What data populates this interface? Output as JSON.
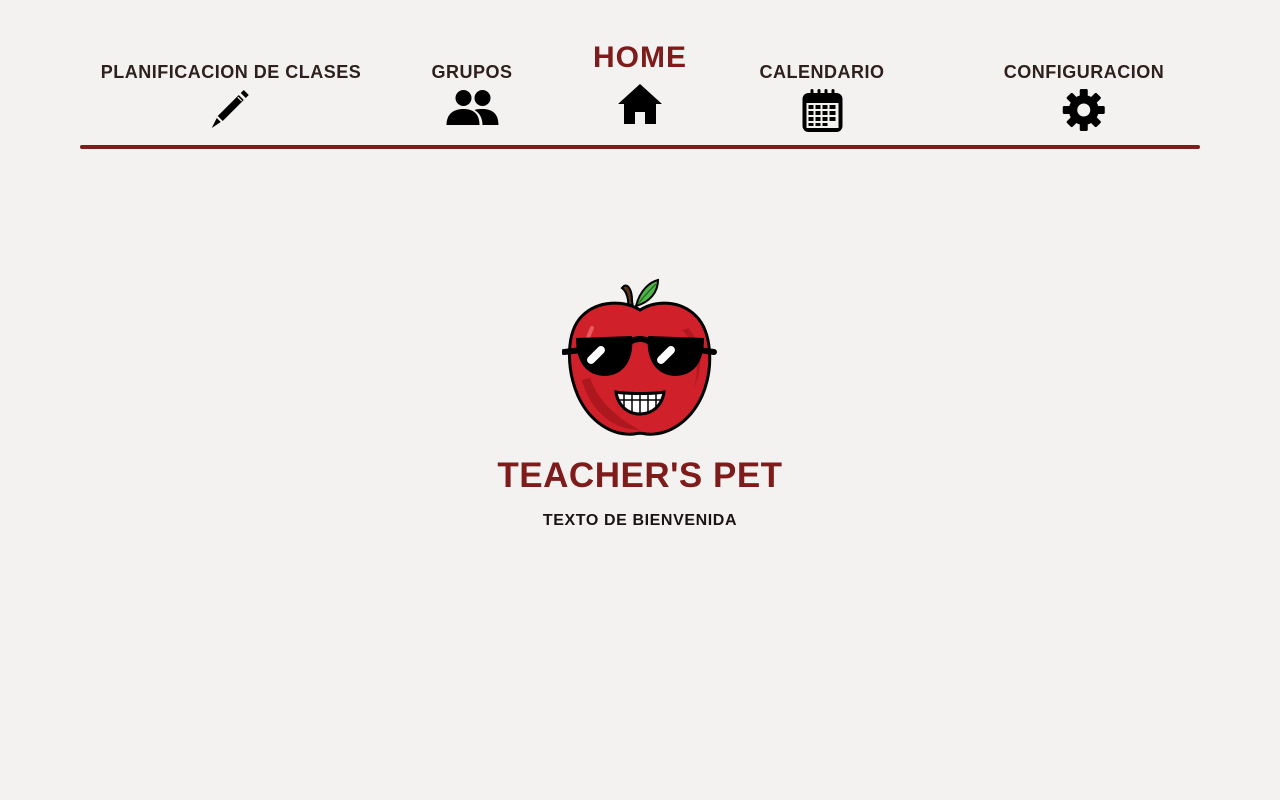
{
  "nav": {
    "items": [
      {
        "label": "PLANIFICACION DE CLASES",
        "icon": "pencil-icon",
        "active": false
      },
      {
        "label": "GRUPOS",
        "icon": "users-icon",
        "active": false
      },
      {
        "label": "HOME",
        "icon": "home-icon",
        "active": true
      },
      {
        "label": "CALENDARIO",
        "icon": "calendar-icon",
        "active": false
      },
      {
        "label": "CONFIGURACION",
        "icon": "gear-icon",
        "active": false
      }
    ]
  },
  "hero": {
    "logo": "apple-sunglasses-mascot",
    "brand": "TEACHER'S PET",
    "welcome": "TEXTO DE BIENVENIDA"
  },
  "colors": {
    "accent": "#7e1c1c",
    "nav_text": "#2e201c",
    "background": "#f4f2f0"
  }
}
